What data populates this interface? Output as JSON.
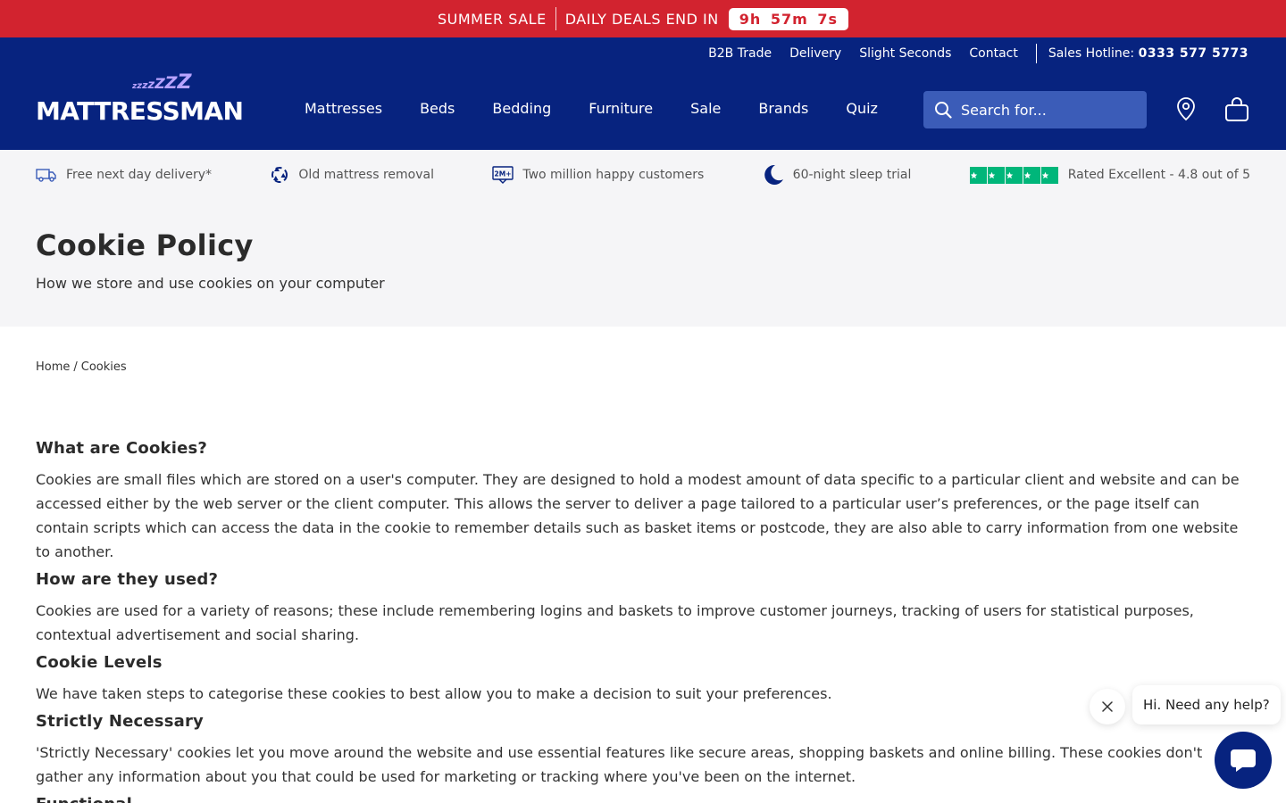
{
  "promo": {
    "sale_label": "SUMMER SALE",
    "deals_label": "DAILY DEALS END IN",
    "countdown": {
      "hours": "9h",
      "minutes": "57m",
      "seconds": "7s"
    }
  },
  "utility_nav": {
    "links": [
      "B2B Trade",
      "Delivery",
      "Slight Seconds",
      "Contact"
    ],
    "hotline_label": "Sales Hotline:",
    "hotline_number": "0333 577 5773"
  },
  "logo": {
    "text": "MATTRESSMAN",
    "zz": "zzzzZZ"
  },
  "main_nav": [
    "Mattresses",
    "Beds",
    "Bedding",
    "Furniture",
    "Sale",
    "Brands",
    "Quiz"
  ],
  "search": {
    "placeholder": "Search for..."
  },
  "usp": [
    {
      "icon": "truck-icon",
      "text": "Free next day delivery*"
    },
    {
      "icon": "recycle-icon",
      "text": "Old mattress removal"
    },
    {
      "icon": "2m-plus-icon",
      "icon_text": "2M+",
      "text": "Two million happy customers"
    },
    {
      "icon": "moon-icon",
      "text": "60-night sleep trial"
    },
    {
      "icon": "trustpilot-stars",
      "text": "Rated Excellent - 4.8 out of 5",
      "rating": 4.8
    }
  ],
  "page": {
    "title": "Cookie Policy",
    "subtitle": "How we store and use cookies on your computer"
  },
  "breadcrumb": {
    "home": "Home",
    "separator": "/",
    "current": "Cookies"
  },
  "sections": [
    {
      "heading": "What are Cookies?",
      "body": "Cookies are small files which are stored on a user's computer. They are designed to hold a modest amount of data specific to a particular client and website and can be accessed either by the web server or the client computer. This allows the server to deliver a page tailored to a particular user’s preferences, or the page itself can contain scripts which can access the data in the cookie to remember details such as basket items or postcode, they are also able to carry information from one website to another."
    },
    {
      "heading": "How are they used?",
      "body": "Cookies are used for a variety of reasons; these include remembering logins and baskets to improve customer journeys, tracking of users for statistical purposes, contextual advertisement and social sharing."
    },
    {
      "heading": "Cookie Levels",
      "body": "We have taken steps to categorise these cookies to best allow you to make a decision to suit your preferences."
    },
    {
      "heading": "Strictly Necessary",
      "body": "'Strictly Necessary' cookies let you move around the website and use essential features like secure areas, shopping baskets and online billing. These cookies don't gather any information about you that could be used for marketing or tracking where you've been on the internet."
    },
    {
      "heading": "Functional",
      "body": ""
    }
  ],
  "chat": {
    "greeting": "Hi. Need any help?"
  },
  "colors": {
    "brand_navy": "#07237f",
    "promo_red": "#d2232f",
    "trustpilot_green": "#00b67a",
    "logo_zz": "#b8a3ff"
  }
}
